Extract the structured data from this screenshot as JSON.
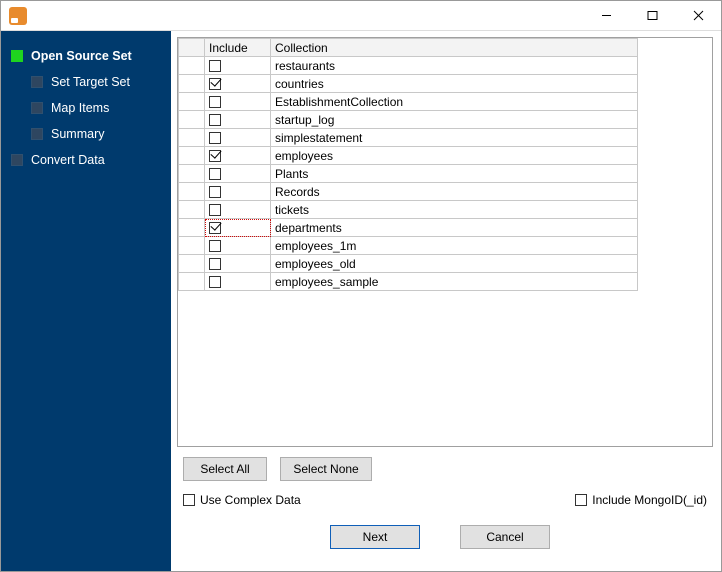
{
  "titlebar": {
    "title": ""
  },
  "nav": {
    "items": [
      {
        "label": "Open Source Set",
        "active": true,
        "child": false
      },
      {
        "label": "Set Target Set",
        "active": false,
        "child": true
      },
      {
        "label": "Map Items",
        "active": false,
        "child": true
      },
      {
        "label": "Summary",
        "active": false,
        "child": true
      },
      {
        "label": "Convert Data",
        "active": false,
        "child": false
      }
    ]
  },
  "grid": {
    "headers": {
      "include": "Include",
      "collection": "Collection"
    },
    "rows": [
      {
        "include": false,
        "collection": "restaurants"
      },
      {
        "include": true,
        "collection": "countries"
      },
      {
        "include": false,
        "collection": "EstablishmentCollection"
      },
      {
        "include": false,
        "collection": "startup_log"
      },
      {
        "include": false,
        "collection": "simplestatement"
      },
      {
        "include": true,
        "collection": "employees"
      },
      {
        "include": false,
        "collection": "Plants"
      },
      {
        "include": false,
        "collection": "Records"
      },
      {
        "include": false,
        "collection": "tickets"
      },
      {
        "include": true,
        "collection": "departments",
        "focused": true
      },
      {
        "include": false,
        "collection": "employees_1m"
      },
      {
        "include": false,
        "collection": "employees_old"
      },
      {
        "include": false,
        "collection": "employees_sample"
      }
    ]
  },
  "buttons": {
    "select_all": "Select All",
    "select_none": "Select None",
    "next": "Next",
    "cancel": "Cancel"
  },
  "options": {
    "use_complex_data": {
      "label": "Use Complex Data",
      "checked": false
    },
    "include_mongoid": {
      "label": "Include MongoID(_id)",
      "checked": false
    }
  }
}
